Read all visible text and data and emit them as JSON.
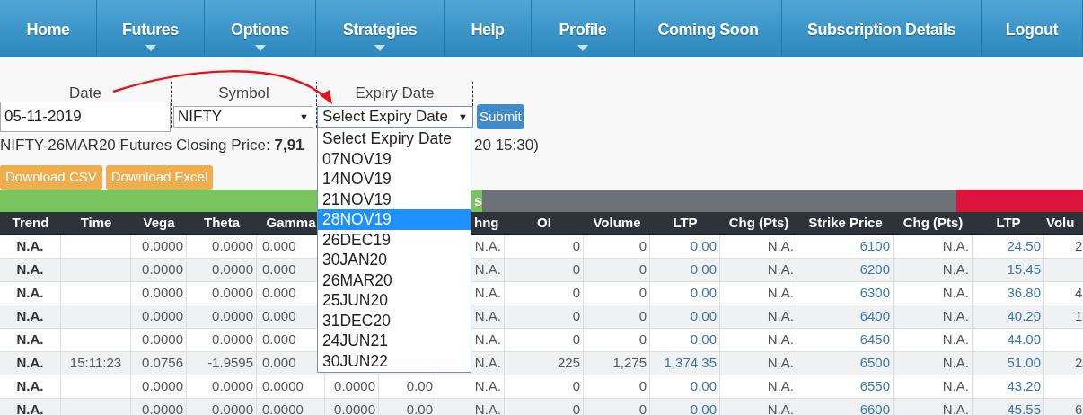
{
  "nav": [
    {
      "label": "Home",
      "has_menu": false
    },
    {
      "label": "Futures",
      "has_menu": true
    },
    {
      "label": "Options",
      "has_menu": true
    },
    {
      "label": "Strategies",
      "has_menu": true
    },
    {
      "label": "Help",
      "has_menu": false
    },
    {
      "label": "Profile",
      "has_menu": true
    },
    {
      "label": "Coming Soon",
      "has_menu": false
    },
    {
      "label": "Subscription Details",
      "has_menu": false
    },
    {
      "label": "Logout",
      "has_menu": false
    }
  ],
  "form": {
    "date_label": "Date",
    "date_value": "05-11-2019",
    "symbol_label": "Symbol",
    "symbol_value": "NIFTY",
    "caret": "▼",
    "expiry_label": "Expiry Date",
    "expiry_value": "Select Expiry Date",
    "submit": "Submit"
  },
  "expiry_options": [
    {
      "label": "Select Expiry Date",
      "selected": false
    },
    {
      "label": "07NOV19",
      "selected": false
    },
    {
      "label": "14NOV19",
      "selected": false
    },
    {
      "label": "21NOV19",
      "selected": false
    },
    {
      "label": "28NOV19",
      "selected": true
    },
    {
      "label": "26DEC19",
      "selected": false
    },
    {
      "label": "30JAN20",
      "selected": false
    },
    {
      "label": "26MAR20",
      "selected": false
    },
    {
      "label": "25JUN20",
      "selected": false
    },
    {
      "label": "31DEC20",
      "selected": false
    },
    {
      "label": "24JUN21",
      "selected": false
    },
    {
      "label": "30JUN22",
      "selected": false
    }
  ],
  "closing_price": "NIFTY-26MAR20 Futures Closing Price: **7,91**",
  "closing_price_tail": "20 15:30)",
  "downloads": [
    "Download CSV",
    "Download Excel"
  ],
  "banner": [
    {
      "label": "s",
      "color": "#79c45c"
    },
    {
      "color": "#6c7278"
    },
    {
      "color": "#dc143c"
    }
  ],
  "columns": [
    {
      "label": "Trend",
      "kind": "bold"
    },
    {
      "label": "Time",
      "kind": "center"
    },
    {
      "label": "Vega",
      "kind": "num"
    },
    {
      "label": "Theta",
      "kind": "num"
    },
    {
      "label": "Gamma",
      "kind": "left"
    },
    {
      "kind": "num"
    },
    {
      "kind": "num"
    },
    {
      "label": "hng",
      "kind": "num"
    },
    {
      "label": "OI",
      "kind": "num"
    },
    {
      "label": "Volume",
      "kind": "num"
    },
    {
      "label": "LTP",
      "kind": "link"
    },
    {
      "label": "Chg (Pts)",
      "kind": "num"
    },
    {
      "label": "Strike Price",
      "kind": "link"
    },
    {
      "label": "Chg (Pts)",
      "kind": "num"
    },
    {
      "label": "LTP",
      "kind": "link"
    },
    {
      "label": "Volu",
      "kind": "edge"
    }
  ],
  "rows": [
    {
      "cells": [
        "N.A.",
        null,
        "0.0000",
        "0.0000",
        "0.000",
        null,
        null,
        "N.A.",
        "0",
        "0",
        "0.00",
        "N.A.",
        "6100",
        "N.A.",
        "24.50",
        "2"
      ]
    },
    {
      "cells": [
        "N.A.",
        null,
        "0.0000",
        "0.0000",
        "0.000",
        null,
        null,
        "N.A.",
        "0",
        "0",
        "0.00",
        "N.A.",
        "6200",
        "N.A.",
        "15.45",
        null
      ]
    },
    {
      "cells": [
        "N.A.",
        null,
        "0.0000",
        "0.0000",
        "0.000",
        null,
        null,
        "N.A.",
        "0",
        "0",
        "0.00",
        "N.A.",
        "6300",
        "N.A.",
        "36.80",
        "4"
      ]
    },
    {
      "cells": [
        "N.A.",
        null,
        "0.0000",
        "0.0000",
        "0.000",
        null,
        null,
        "N.A.",
        "0",
        "0",
        "0.00",
        "N.A.",
        "6400",
        "N.A.",
        "40.20",
        "1"
      ]
    },
    {
      "cells": [
        "N.A.",
        null,
        "0.0000",
        "0.0000",
        "0.000",
        null,
        null,
        "N.A.",
        "0",
        "0",
        "0.00",
        "N.A.",
        "6450",
        "N.A.",
        "44.00",
        null
      ]
    },
    {
      "cells": [
        "N.A.",
        "15:11:23",
        "0.0756",
        "-1.9595",
        "0.000",
        null,
        null,
        "N.A.",
        "225",
        "1,275",
        "1,374.35",
        "N.A.",
        "6500",
        "N.A.",
        "51.00",
        "2"
      ]
    },
    {
      "cells": [
        "N.A.",
        null,
        "0.0000",
        "0.0000",
        "0.0000",
        "0.0000",
        "0.00",
        "N.A.",
        "0",
        "0",
        "0.00",
        "N.A.",
        "6550",
        "N.A.",
        "43.20",
        null
      ]
    },
    {
      "cells": [
        "N.A.",
        null,
        "0.0000",
        "0.0000",
        "0.0000",
        "0.0000",
        "0.00",
        "N.A.",
        "0",
        "0",
        "0.00",
        "N.A.",
        "6600",
        "N.A.",
        "45.55",
        "6"
      ]
    }
  ]
}
